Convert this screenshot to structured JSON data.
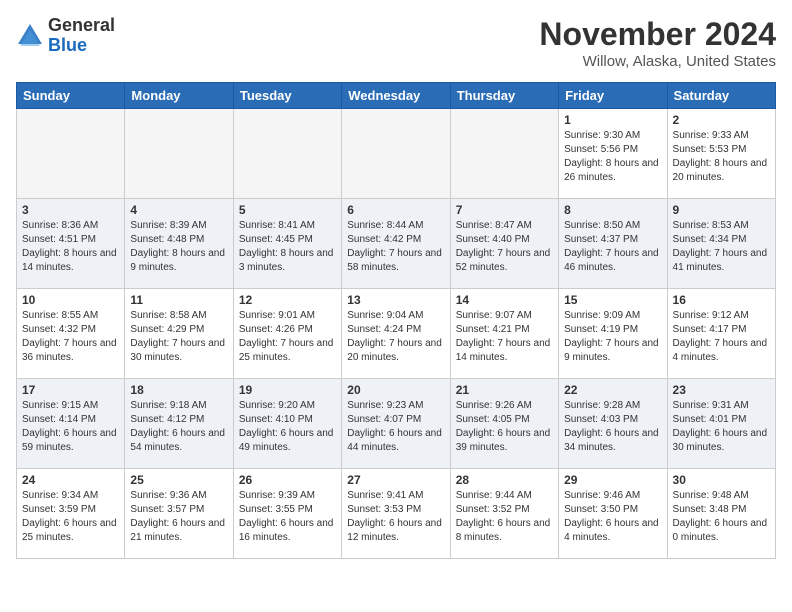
{
  "header": {
    "logo_general": "General",
    "logo_blue": "Blue",
    "month_title": "November 2024",
    "location": "Willow, Alaska, United States"
  },
  "days_of_week": [
    "Sunday",
    "Monday",
    "Tuesday",
    "Wednesday",
    "Thursday",
    "Friday",
    "Saturday"
  ],
  "weeks": [
    {
      "row_class": "row-even",
      "days": [
        {
          "num": "",
          "info": "",
          "empty": true
        },
        {
          "num": "",
          "info": "",
          "empty": true
        },
        {
          "num": "",
          "info": "",
          "empty": true
        },
        {
          "num": "",
          "info": "",
          "empty": true
        },
        {
          "num": "",
          "info": "",
          "empty": true
        },
        {
          "num": "1",
          "info": "Sunrise: 9:30 AM\nSunset: 5:56 PM\nDaylight: 8 hours and 26 minutes.",
          "empty": false
        },
        {
          "num": "2",
          "info": "Sunrise: 9:33 AM\nSunset: 5:53 PM\nDaylight: 8 hours and 20 minutes.",
          "empty": false
        }
      ]
    },
    {
      "row_class": "row-odd",
      "days": [
        {
          "num": "3",
          "info": "Sunrise: 8:36 AM\nSunset: 4:51 PM\nDaylight: 8 hours and 14 minutes.",
          "empty": false
        },
        {
          "num": "4",
          "info": "Sunrise: 8:39 AM\nSunset: 4:48 PM\nDaylight: 8 hours and 9 minutes.",
          "empty": false
        },
        {
          "num": "5",
          "info": "Sunrise: 8:41 AM\nSunset: 4:45 PM\nDaylight: 8 hours and 3 minutes.",
          "empty": false
        },
        {
          "num": "6",
          "info": "Sunrise: 8:44 AM\nSunset: 4:42 PM\nDaylight: 7 hours and 58 minutes.",
          "empty": false
        },
        {
          "num": "7",
          "info": "Sunrise: 8:47 AM\nSunset: 4:40 PM\nDaylight: 7 hours and 52 minutes.",
          "empty": false
        },
        {
          "num": "8",
          "info": "Sunrise: 8:50 AM\nSunset: 4:37 PM\nDaylight: 7 hours and 46 minutes.",
          "empty": false
        },
        {
          "num": "9",
          "info": "Sunrise: 8:53 AM\nSunset: 4:34 PM\nDaylight: 7 hours and 41 minutes.",
          "empty": false
        }
      ]
    },
    {
      "row_class": "row-even",
      "days": [
        {
          "num": "10",
          "info": "Sunrise: 8:55 AM\nSunset: 4:32 PM\nDaylight: 7 hours and 36 minutes.",
          "empty": false
        },
        {
          "num": "11",
          "info": "Sunrise: 8:58 AM\nSunset: 4:29 PM\nDaylight: 7 hours and 30 minutes.",
          "empty": false
        },
        {
          "num": "12",
          "info": "Sunrise: 9:01 AM\nSunset: 4:26 PM\nDaylight: 7 hours and 25 minutes.",
          "empty": false
        },
        {
          "num": "13",
          "info": "Sunrise: 9:04 AM\nSunset: 4:24 PM\nDaylight: 7 hours and 20 minutes.",
          "empty": false
        },
        {
          "num": "14",
          "info": "Sunrise: 9:07 AM\nSunset: 4:21 PM\nDaylight: 7 hours and 14 minutes.",
          "empty": false
        },
        {
          "num": "15",
          "info": "Sunrise: 9:09 AM\nSunset: 4:19 PM\nDaylight: 7 hours and 9 minutes.",
          "empty": false
        },
        {
          "num": "16",
          "info": "Sunrise: 9:12 AM\nSunset: 4:17 PM\nDaylight: 7 hours and 4 minutes.",
          "empty": false
        }
      ]
    },
    {
      "row_class": "row-odd",
      "days": [
        {
          "num": "17",
          "info": "Sunrise: 9:15 AM\nSunset: 4:14 PM\nDaylight: 6 hours and 59 minutes.",
          "empty": false
        },
        {
          "num": "18",
          "info": "Sunrise: 9:18 AM\nSunset: 4:12 PM\nDaylight: 6 hours and 54 minutes.",
          "empty": false
        },
        {
          "num": "19",
          "info": "Sunrise: 9:20 AM\nSunset: 4:10 PM\nDaylight: 6 hours and 49 minutes.",
          "empty": false
        },
        {
          "num": "20",
          "info": "Sunrise: 9:23 AM\nSunset: 4:07 PM\nDaylight: 6 hours and 44 minutes.",
          "empty": false
        },
        {
          "num": "21",
          "info": "Sunrise: 9:26 AM\nSunset: 4:05 PM\nDaylight: 6 hours and 39 minutes.",
          "empty": false
        },
        {
          "num": "22",
          "info": "Sunrise: 9:28 AM\nSunset: 4:03 PM\nDaylight: 6 hours and 34 minutes.",
          "empty": false
        },
        {
          "num": "23",
          "info": "Sunrise: 9:31 AM\nSunset: 4:01 PM\nDaylight: 6 hours and 30 minutes.",
          "empty": false
        }
      ]
    },
    {
      "row_class": "row-even",
      "days": [
        {
          "num": "24",
          "info": "Sunrise: 9:34 AM\nSunset: 3:59 PM\nDaylight: 6 hours and 25 minutes.",
          "empty": false
        },
        {
          "num": "25",
          "info": "Sunrise: 9:36 AM\nSunset: 3:57 PM\nDaylight: 6 hours and 21 minutes.",
          "empty": false
        },
        {
          "num": "26",
          "info": "Sunrise: 9:39 AM\nSunset: 3:55 PM\nDaylight: 6 hours and 16 minutes.",
          "empty": false
        },
        {
          "num": "27",
          "info": "Sunrise: 9:41 AM\nSunset: 3:53 PM\nDaylight: 6 hours and 12 minutes.",
          "empty": false
        },
        {
          "num": "28",
          "info": "Sunrise: 9:44 AM\nSunset: 3:52 PM\nDaylight: 6 hours and 8 minutes.",
          "empty": false
        },
        {
          "num": "29",
          "info": "Sunrise: 9:46 AM\nSunset: 3:50 PM\nDaylight: 6 hours and 4 minutes.",
          "empty": false
        },
        {
          "num": "30",
          "info": "Sunrise: 9:48 AM\nSunset: 3:48 PM\nDaylight: 6 hours and 0 minutes.",
          "empty": false
        }
      ]
    }
  ]
}
